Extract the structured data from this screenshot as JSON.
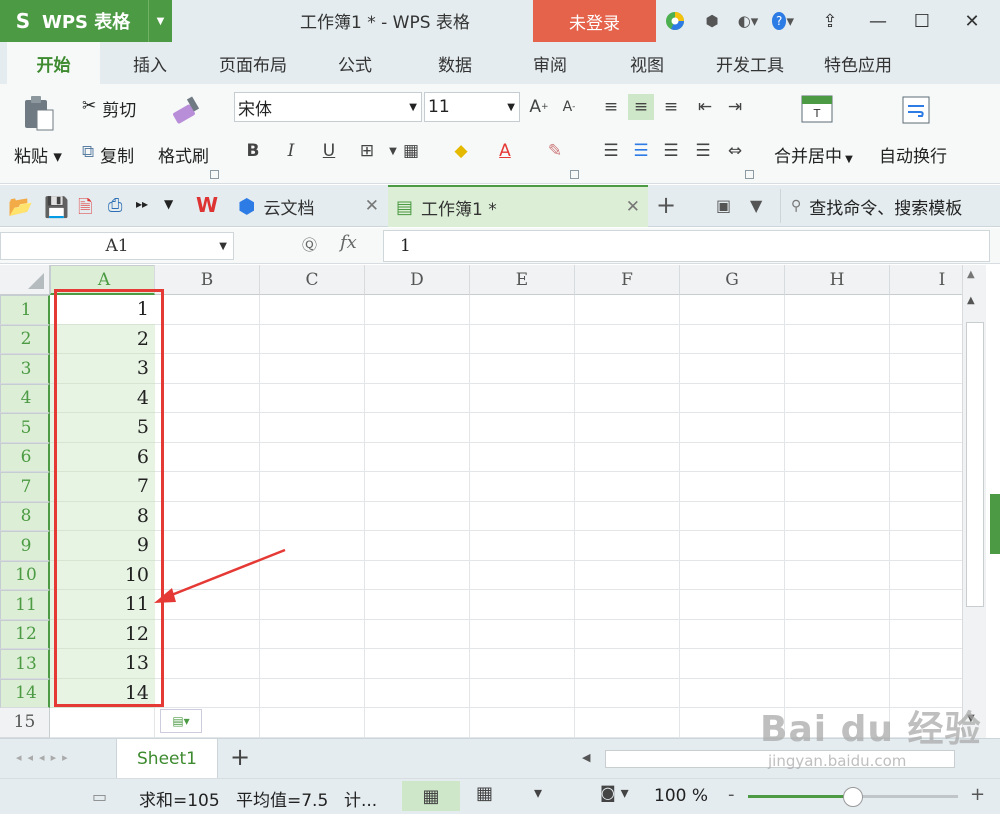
{
  "titlebar": {
    "app_name": "WPS 表格",
    "app_logo": "S",
    "window_title": "工作簿1 * - WPS 表格",
    "login_label": "未登录",
    "colors": {
      "app_green": "#4c9a43",
      "login_red": "#e5624b"
    }
  },
  "ribbon_tabs": [
    "开始",
    "插入",
    "页面布局",
    "公式",
    "数据",
    "审阅",
    "视图",
    "开发工具",
    "特色应用"
  ],
  "ribbon": {
    "paste": "粘贴",
    "cut": "剪切",
    "copy": "复制",
    "format_painter": "格式刷",
    "font_name": "宋体",
    "font_size": "11",
    "merge_center": "合并居中",
    "wrap_text": "自动换行"
  },
  "doc_tabs": {
    "cloud_docs": "云文档",
    "workbook": "工作簿1 *",
    "search_placeholder": "查找命令、搜索模板"
  },
  "formula_bar": {
    "name_box": "A1",
    "fx_label": "fx",
    "content": "1"
  },
  "grid": {
    "columns": [
      "A",
      "B",
      "C",
      "D",
      "E",
      "F",
      "G",
      "H",
      "I"
    ],
    "rows": [
      "1",
      "2",
      "3",
      "4",
      "5",
      "6",
      "7",
      "8",
      "9",
      "10",
      "11",
      "12",
      "13",
      "14",
      "15"
    ],
    "col_a_values": [
      "1",
      "2",
      "3",
      "4",
      "5",
      "6",
      "7",
      "8",
      "9",
      "10",
      "11",
      "12",
      "13",
      "14"
    ]
  },
  "sheets": {
    "active": "Sheet1",
    "add_symbol": "+"
  },
  "status": {
    "sum": "求和=105",
    "avg": "平均值=7.5",
    "count": "计...",
    "zoom": "100 %",
    "zoom_fraction": 0.5
  },
  "watermark": {
    "brand": "Bai du 经验",
    "url": "jingyan.baidu.com"
  }
}
